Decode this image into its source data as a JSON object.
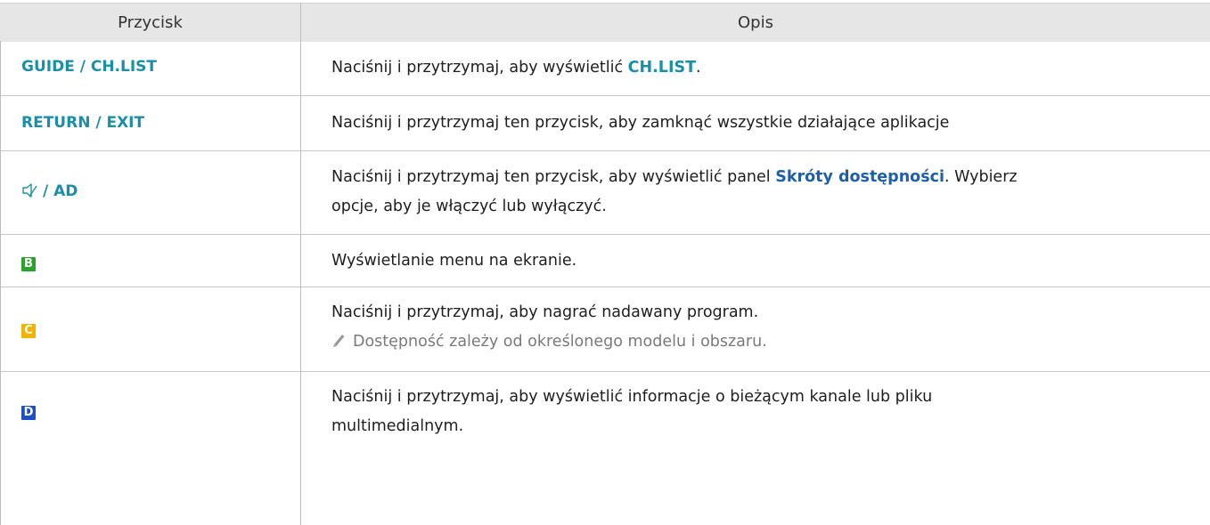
{
  "header": {
    "col1": "Przycisk",
    "col2": "Opis"
  },
  "rows": [
    {
      "key": "GUIDE / CH.LIST",
      "desc_pre": "Naciśnij i przytrzymaj, aby wyświetlić ",
      "desc_hl": "CH.LIST",
      "desc_post": "."
    },
    {
      "key": "RETURN / EXIT",
      "desc": "Naciśnij i przytrzymaj ten przycisk, aby zamknąć wszystkie działające aplikacje"
    },
    {
      "key_icon": "audio-description-icon",
      "key": "/ AD",
      "desc_pre": "Naciśnij i przytrzymaj ten przycisk, aby wyświetlić panel ",
      "desc_hl": "Skróty dostępności",
      "desc_post": ". Wybierz",
      "desc_line2": "opcje, aby je włączyć lub wyłączyć."
    },
    {
      "key_box": "B",
      "key_color": "#2aa32a",
      "desc": "Wyświetlanie menu na ekranie."
    },
    {
      "key_box": "C",
      "key_color": "#f0b400",
      "desc": "Naciśnij i przytrzymaj, aby nagrać nadawany program.",
      "note_icon": "pencil-icon",
      "note": "Dostępność zależy od określonego modelu i obszaru."
    },
    {
      "key_box": "D",
      "key_color": "#1f4fc4",
      "desc": "Naciśnij i przytrzymaj, aby wyświetlić informacje o bieżącym kanale lub pliku",
      "desc_line2": "multimedialnym."
    }
  ]
}
